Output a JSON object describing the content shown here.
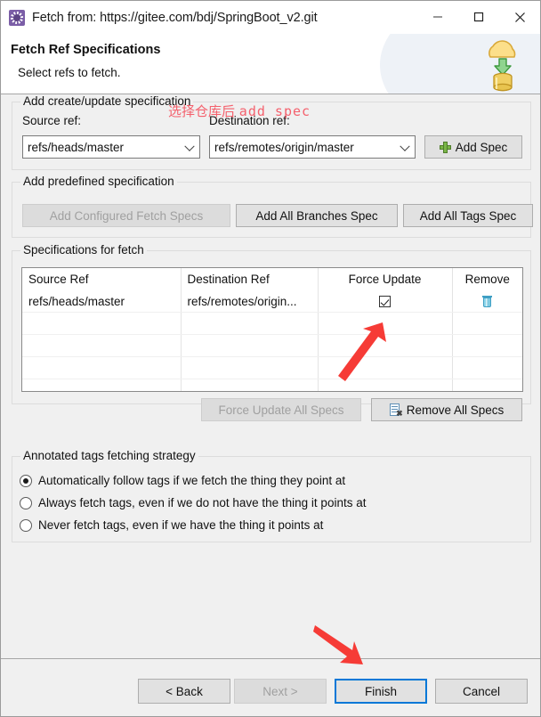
{
  "window": {
    "title": "Fetch from: https://gitee.com/bdj/SpringBoot_v2.git",
    "app_icon": "gear-icon",
    "minimize": "−",
    "maximize": "□",
    "close": "✕"
  },
  "header": {
    "title": "Fetch Ref Specifications",
    "subtitle": "Select refs to fetch.",
    "icon": "cloud-download-database-icon"
  },
  "annotation": {
    "cn": "选择仓库后",
    "en": "add spec",
    "color": "#f4616d"
  },
  "create_update_group": {
    "title": "Add create/update specification",
    "source_label": "Source ref:",
    "destination_label": "Destination ref:",
    "source_value": "refs/heads/master",
    "destination_value": "refs/remotes/origin/master",
    "add_spec_button": "Add Spec",
    "add_spec_icon": "green-plus-icon"
  },
  "predefined_group": {
    "title": "Add predefined specification",
    "buttons": [
      {
        "label": "Add Configured Fetch Specs",
        "enabled": false
      },
      {
        "label": "Add All Branches Spec",
        "enabled": true
      },
      {
        "label": "Add All Tags Spec",
        "enabled": true
      }
    ]
  },
  "specs_group": {
    "title": "Specifications for fetch",
    "columns": [
      "Source Ref",
      "Destination Ref",
      "Force Update",
      "Remove"
    ],
    "rows": [
      {
        "source": "refs/heads/master",
        "destination": "refs/remotes/origin...",
        "force_update": true,
        "remove_icon": "trash-icon"
      }
    ],
    "empty_row_count": 5,
    "force_update_all_button": "Force Update All Specs",
    "force_update_all_enabled": false,
    "remove_all_button": "Remove All Specs",
    "remove_all_icon": "remove-document-icon"
  },
  "tags_group": {
    "title": "Annotated tags fetching strategy",
    "options": [
      {
        "label": "Automatically follow tags if we fetch the thing they point at",
        "selected": true
      },
      {
        "label": "Always fetch tags, even if we do not have the thing it points at",
        "selected": false
      },
      {
        "label": "Never fetch tags, even if we have the thing it points at",
        "selected": false
      }
    ]
  },
  "footer": {
    "back": "< Back",
    "next": "Next >",
    "next_enabled": false,
    "finish": "Finish",
    "finish_is_default": true,
    "cancel": "Cancel"
  }
}
